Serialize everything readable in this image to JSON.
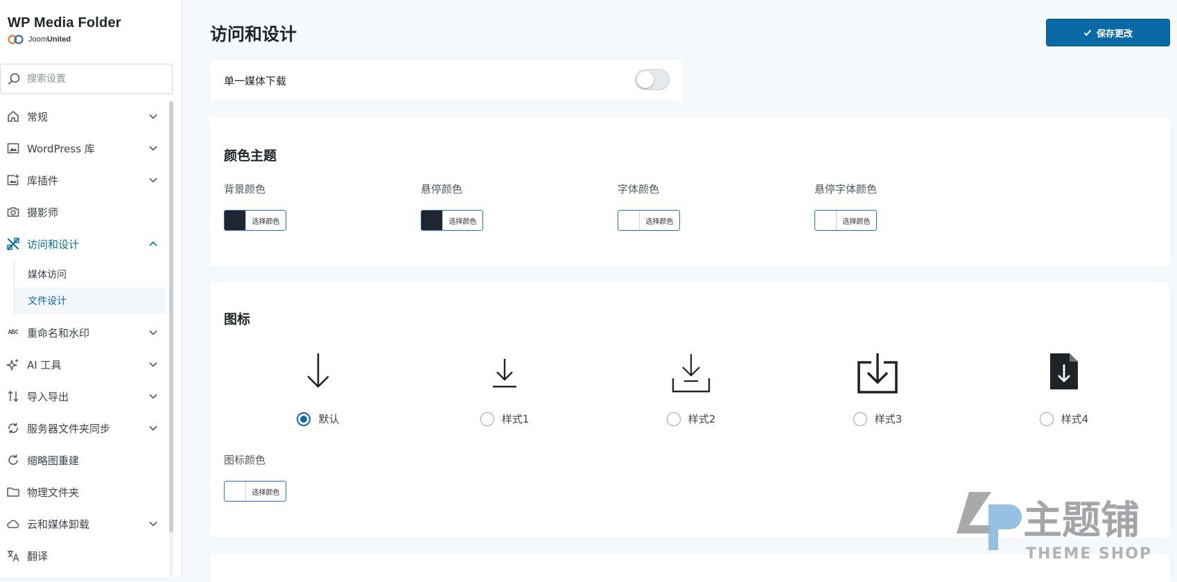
{
  "brand": {
    "title": "WP Media Folder",
    "sub_plain": "Joom",
    "sub_bold": "United"
  },
  "search": {
    "placeholder": "搜索设置"
  },
  "sidebar": {
    "items": [
      {
        "label": "常规",
        "icon": "home-icon",
        "expandable": true
      },
      {
        "label": "WordPress 库",
        "icon": "image-icon",
        "expandable": true
      },
      {
        "label": "库插件",
        "icon": "image-plus-icon",
        "expandable": true
      },
      {
        "label": "摄影师",
        "icon": "camera-icon",
        "expandable": false
      },
      {
        "label": "访问和设计",
        "icon": "design-tools-icon",
        "expandable": true,
        "active": true,
        "children": [
          {
            "label": "媒体访问"
          },
          {
            "label": "文件设计",
            "active": true
          }
        ]
      },
      {
        "label": "重命名和水印",
        "icon": "abc-icon",
        "icon_text": "ABC",
        "expandable": true
      },
      {
        "label": "AI 工具",
        "icon": "sparkle-icon",
        "expandable": true
      },
      {
        "label": "导入导出",
        "icon": "import-export-icon",
        "expandable": true
      },
      {
        "label": "服务器文件夹同步",
        "icon": "sync-icon",
        "expandable": true
      },
      {
        "label": "缩略图重建",
        "icon": "refresh-icon",
        "expandable": false
      },
      {
        "label": "物理文件夹",
        "icon": "folder-icon",
        "expandable": false
      },
      {
        "label": "云和媒体卸载",
        "icon": "cloud-icon",
        "expandable": true
      },
      {
        "label": "翻译",
        "icon": "translate-icon",
        "expandable": false
      }
    ]
  },
  "header": {
    "title": "访问和设计",
    "save_label": "保存更改"
  },
  "single_download": {
    "label": "单一媒体下载",
    "enabled": false
  },
  "color_theme": {
    "title": "颜色主题",
    "button_label": "选择颜色",
    "fields": [
      {
        "label": "背景颜色",
        "color": "#202533"
      },
      {
        "label": "悬停颜色",
        "color": "#202533"
      },
      {
        "label": "字体颜色",
        "color": "#ffffff"
      },
      {
        "label": "悬停字体颜色",
        "color": "#ffffff"
      }
    ]
  },
  "icons": {
    "title": "图标",
    "options": [
      {
        "label": "默认",
        "icon": "arrow-down-icon",
        "checked": true
      },
      {
        "label": "样式1",
        "icon": "download-line-icon",
        "checked": false
      },
      {
        "label": "样式2",
        "icon": "download-tray-icon",
        "checked": false
      },
      {
        "label": "样式3",
        "icon": "download-box-icon",
        "checked": false
      },
      {
        "label": "样式4",
        "icon": "download-file-icon",
        "checked": false
      }
    ],
    "color_label": "图标颜色",
    "color_button_label": "选择颜色",
    "color": "#ffffff"
  },
  "watermark": {
    "main": "主题铺",
    "sub": "THEME SHOP"
  },
  "colors": {
    "accent": "#0a6aa7",
    "button": "#0b6aa6"
  }
}
